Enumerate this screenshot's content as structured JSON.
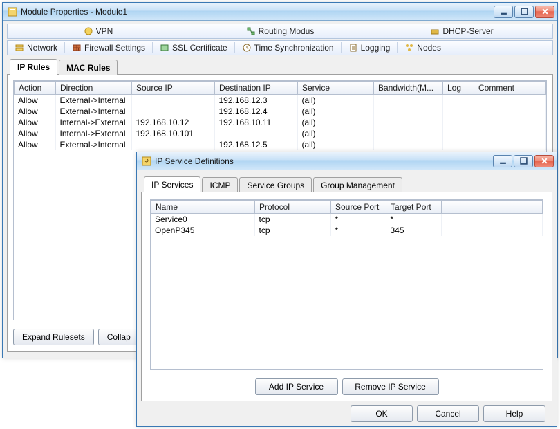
{
  "main_window": {
    "title": "Module Properties - Module1",
    "nav1": {
      "vpn": "VPN",
      "routing": "Routing Modus",
      "dhcp": "DHCP-Server"
    },
    "nav2": {
      "network": "Network",
      "firewall": "Firewall Settings",
      "ssl": "SSL Certificate",
      "time": "Time Synchronization",
      "logging": "Logging",
      "nodes": "Nodes"
    },
    "subtabs": {
      "ip": "IP Rules",
      "mac": "MAC Rules"
    },
    "cols": {
      "action": "Action",
      "direction": "Direction",
      "srcip": "Source IP",
      "dstip": "Destination IP",
      "service": "Service",
      "bw": "Bandwidth(M...",
      "log": "Log",
      "comment": "Comment"
    },
    "rows": [
      {
        "action": "Allow",
        "direction": "External->Internal",
        "srcip": "",
        "dstip": "192.168.12.3",
        "service": "(all)"
      },
      {
        "action": "Allow",
        "direction": "External->Internal",
        "srcip": "",
        "dstip": "192.168.12.4",
        "service": "(all)"
      },
      {
        "action": "Allow",
        "direction": "Internal->External",
        "srcip": "192.168.10.12",
        "dstip": "192.168.10.11",
        "service": "(all)"
      },
      {
        "action": "Allow",
        "direction": "Internal->External",
        "srcip": "192.168.10.101",
        "dstip": "",
        "service": "(all)"
      },
      {
        "action": "Allow",
        "direction": "External->Internal",
        "srcip": "",
        "dstip": "192.168.12.5",
        "service": "(all)"
      }
    ],
    "buttons": {
      "expand": "Expand Rulesets",
      "collapse": "Collap"
    }
  },
  "dialog": {
    "title": "IP Service Definitions",
    "tabs": {
      "ipservices": "IP Services",
      "icmp": "ICMP",
      "groups": "Service Groups",
      "mgmt": "Group Management"
    },
    "cols": {
      "name": "Name",
      "protocol": "Protocol",
      "srcport": "Source Port",
      "tgtport": "Target Port"
    },
    "rows": [
      {
        "name": "Service0",
        "protocol": "tcp",
        "srcport": "*",
        "tgtport": "*"
      },
      {
        "name": "OpenP345",
        "protocol": "tcp",
        "srcport": "*",
        "tgtport": "345"
      }
    ],
    "buttons": {
      "add": "Add IP Service",
      "remove": "Remove IP Service",
      "ok": "OK",
      "cancel": "Cancel",
      "help": "Help"
    }
  }
}
